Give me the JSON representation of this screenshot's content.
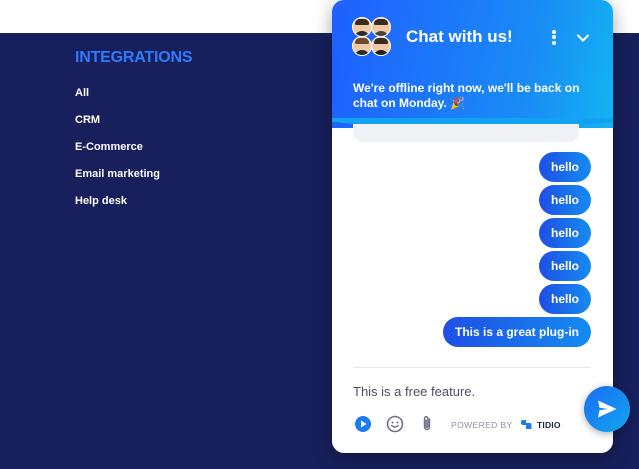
{
  "integrations": {
    "title": "INTEGRATIONS",
    "items": [
      "All",
      "CRM",
      "E-Commerce",
      "Email marketing",
      "Help desk"
    ]
  },
  "chat": {
    "title": "Chat with us!",
    "offline_message": "We're offline right now, we'll be back on chat on Monday.",
    "offline_emoji": "🎉",
    "messages": [
      "hello",
      "hello",
      "hello",
      "hello",
      "hello",
      "This is a great plug-in"
    ],
    "composer_value": "This is a free feature.",
    "powered_by": "POWERED BY",
    "brand": "TIDIO"
  },
  "colors": {
    "footer_bg": "#17205c",
    "accent": "#2f7bff",
    "bubble_start": "#1e4fe6",
    "bubble_end": "#168bf0"
  },
  "icons": {
    "menu": "more-vertical-icon",
    "collapse": "chevron-down-icon",
    "play": "play-icon",
    "emoji": "smiley-icon",
    "attach": "paperclip-icon",
    "send": "send-icon"
  }
}
